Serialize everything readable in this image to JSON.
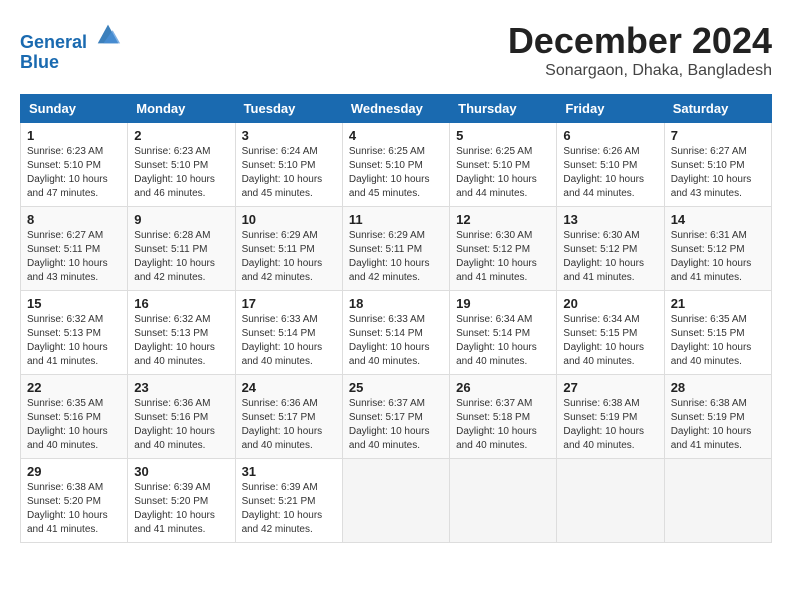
{
  "header": {
    "logo_line1": "General",
    "logo_line2": "Blue",
    "month_title": "December 2024",
    "subtitle": "Sonargaon, Dhaka, Bangladesh"
  },
  "weekdays": [
    "Sunday",
    "Monday",
    "Tuesday",
    "Wednesday",
    "Thursday",
    "Friday",
    "Saturday"
  ],
  "weeks": [
    [
      {
        "day": "1",
        "sunrise": "6:23 AM",
        "sunset": "5:10 PM",
        "daylight": "10 hours and 47 minutes."
      },
      {
        "day": "2",
        "sunrise": "6:23 AM",
        "sunset": "5:10 PM",
        "daylight": "10 hours and 46 minutes."
      },
      {
        "day": "3",
        "sunrise": "6:24 AM",
        "sunset": "5:10 PM",
        "daylight": "10 hours and 45 minutes."
      },
      {
        "day": "4",
        "sunrise": "6:25 AM",
        "sunset": "5:10 PM",
        "daylight": "10 hours and 45 minutes."
      },
      {
        "day": "5",
        "sunrise": "6:25 AM",
        "sunset": "5:10 PM",
        "daylight": "10 hours and 44 minutes."
      },
      {
        "day": "6",
        "sunrise": "6:26 AM",
        "sunset": "5:10 PM",
        "daylight": "10 hours and 44 minutes."
      },
      {
        "day": "7",
        "sunrise": "6:27 AM",
        "sunset": "5:10 PM",
        "daylight": "10 hours and 43 minutes."
      }
    ],
    [
      {
        "day": "8",
        "sunrise": "6:27 AM",
        "sunset": "5:11 PM",
        "daylight": "10 hours and 43 minutes."
      },
      {
        "day": "9",
        "sunrise": "6:28 AM",
        "sunset": "5:11 PM",
        "daylight": "10 hours and 42 minutes."
      },
      {
        "day": "10",
        "sunrise": "6:29 AM",
        "sunset": "5:11 PM",
        "daylight": "10 hours and 42 minutes."
      },
      {
        "day": "11",
        "sunrise": "6:29 AM",
        "sunset": "5:11 PM",
        "daylight": "10 hours and 42 minutes."
      },
      {
        "day": "12",
        "sunrise": "6:30 AM",
        "sunset": "5:12 PM",
        "daylight": "10 hours and 41 minutes."
      },
      {
        "day": "13",
        "sunrise": "6:30 AM",
        "sunset": "5:12 PM",
        "daylight": "10 hours and 41 minutes."
      },
      {
        "day": "14",
        "sunrise": "6:31 AM",
        "sunset": "5:12 PM",
        "daylight": "10 hours and 41 minutes."
      }
    ],
    [
      {
        "day": "15",
        "sunrise": "6:32 AM",
        "sunset": "5:13 PM",
        "daylight": "10 hours and 41 minutes."
      },
      {
        "day": "16",
        "sunrise": "6:32 AM",
        "sunset": "5:13 PM",
        "daylight": "10 hours and 40 minutes."
      },
      {
        "day": "17",
        "sunrise": "6:33 AM",
        "sunset": "5:14 PM",
        "daylight": "10 hours and 40 minutes."
      },
      {
        "day": "18",
        "sunrise": "6:33 AM",
        "sunset": "5:14 PM",
        "daylight": "10 hours and 40 minutes."
      },
      {
        "day": "19",
        "sunrise": "6:34 AM",
        "sunset": "5:14 PM",
        "daylight": "10 hours and 40 minutes."
      },
      {
        "day": "20",
        "sunrise": "6:34 AM",
        "sunset": "5:15 PM",
        "daylight": "10 hours and 40 minutes."
      },
      {
        "day": "21",
        "sunrise": "6:35 AM",
        "sunset": "5:15 PM",
        "daylight": "10 hours and 40 minutes."
      }
    ],
    [
      {
        "day": "22",
        "sunrise": "6:35 AM",
        "sunset": "5:16 PM",
        "daylight": "10 hours and 40 minutes."
      },
      {
        "day": "23",
        "sunrise": "6:36 AM",
        "sunset": "5:16 PM",
        "daylight": "10 hours and 40 minutes."
      },
      {
        "day": "24",
        "sunrise": "6:36 AM",
        "sunset": "5:17 PM",
        "daylight": "10 hours and 40 minutes."
      },
      {
        "day": "25",
        "sunrise": "6:37 AM",
        "sunset": "5:17 PM",
        "daylight": "10 hours and 40 minutes."
      },
      {
        "day": "26",
        "sunrise": "6:37 AM",
        "sunset": "5:18 PM",
        "daylight": "10 hours and 40 minutes."
      },
      {
        "day": "27",
        "sunrise": "6:38 AM",
        "sunset": "5:19 PM",
        "daylight": "10 hours and 40 minutes."
      },
      {
        "day": "28",
        "sunrise": "6:38 AM",
        "sunset": "5:19 PM",
        "daylight": "10 hours and 41 minutes."
      }
    ],
    [
      {
        "day": "29",
        "sunrise": "6:38 AM",
        "sunset": "5:20 PM",
        "daylight": "10 hours and 41 minutes."
      },
      {
        "day": "30",
        "sunrise": "6:39 AM",
        "sunset": "5:20 PM",
        "daylight": "10 hours and 41 minutes."
      },
      {
        "day": "31",
        "sunrise": "6:39 AM",
        "sunset": "5:21 PM",
        "daylight": "10 hours and 42 minutes."
      },
      null,
      null,
      null,
      null
    ]
  ]
}
